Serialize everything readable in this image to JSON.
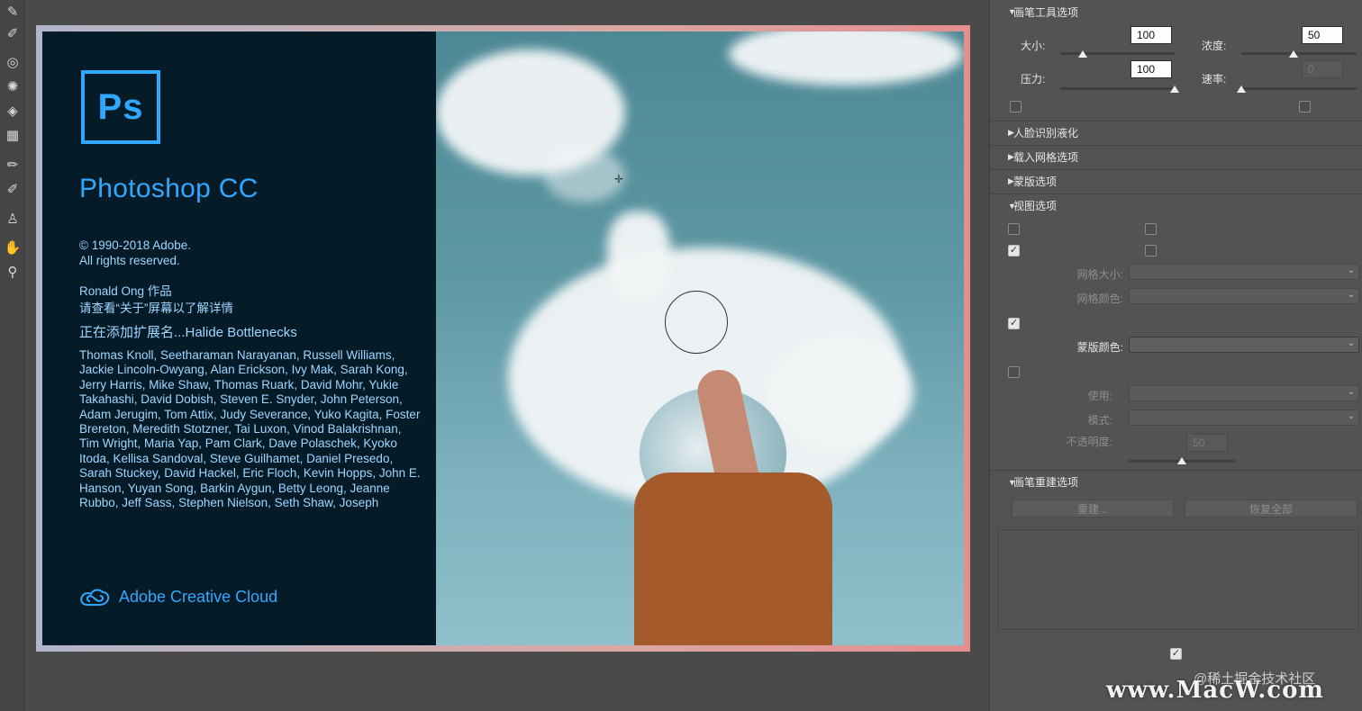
{
  "splash": {
    "logo_text": "Ps",
    "title": "Photoshop CC",
    "copyright": "© 1990-2018 Adobe.",
    "rights": "All rights reserved.",
    "artwork_by": "Ronald Ong 作品",
    "see_about": "请查看“关于”屏幕以了解详情",
    "loading": "正在添加扩展名...Halide Bottlenecks",
    "credits": "Thomas Knoll, Seetharaman Narayanan, Russell Williams, Jackie Lincoln-Owyang, Alan Erickson, Ivy Mak, Sarah Kong, Jerry Harris, Mike Shaw, Thomas Ruark, David Mohr, Yukie Takahashi, David Dobish, Steven E. Snyder, John Peterson, Adam Jerugim, Tom Attix, Judy Severance, Yuko Kagita, Foster Brereton, Meredith Stotzner, Tai Luxon, Vinod Balakrishnan, Tim Wright, Maria Yap, Pam Clark, Dave Polaschek, Kyoko Itoda, Kellisa Sandoval, Steve Guilhamet, Daniel Presedo, Sarah Stuckey, David Hackel, Eric Floch, Kevin Hopps, John E. Hanson, Yuyan Song, Barkin Aygun, Betty Leong, Jeanne Rubbo, Jeff Sass, Stephen Nielson, Seth Shaw, Joseph",
    "cc_label": "Adobe Creative Cloud"
  },
  "panel": {
    "brush_tool_options": {
      "title": "画笔工具选项",
      "size_label": "大小:",
      "size_value": "100",
      "density_label": "浓度:",
      "density_value": "50",
      "pressure_label": "压力:",
      "pressure_value": "100",
      "rate_label": "速率:",
      "rate_value": "0",
      "size_level": 0.2,
      "density_level": 0.45,
      "pressure_level": 1.0,
      "rate_level": 0.0
    },
    "face_aware": {
      "title": "人脸识别液化"
    },
    "load_mesh": {
      "title": "载入网格选项"
    },
    "mask_options": {
      "title": "蒙版选项"
    },
    "view_options": {
      "title": "视图选项",
      "mesh_size_label": "网格大小:",
      "mesh_color_label": "网格颜色:",
      "mask_color_label": "蒙版颜色:",
      "use_label": "使用:",
      "mode_label": "模式:",
      "opacity_label": "不透明度:",
      "opacity_value": "50",
      "opacity_level": 0.5
    },
    "brush_reconstruct": {
      "title": "画笔重建选项",
      "reconstruct_label": "重建...",
      "restore_all_label": "恢复全部"
    }
  },
  "overlay": {
    "watermark": "www.MacW.com",
    "watermark_small": "@稀土掘金技术社区"
  }
}
